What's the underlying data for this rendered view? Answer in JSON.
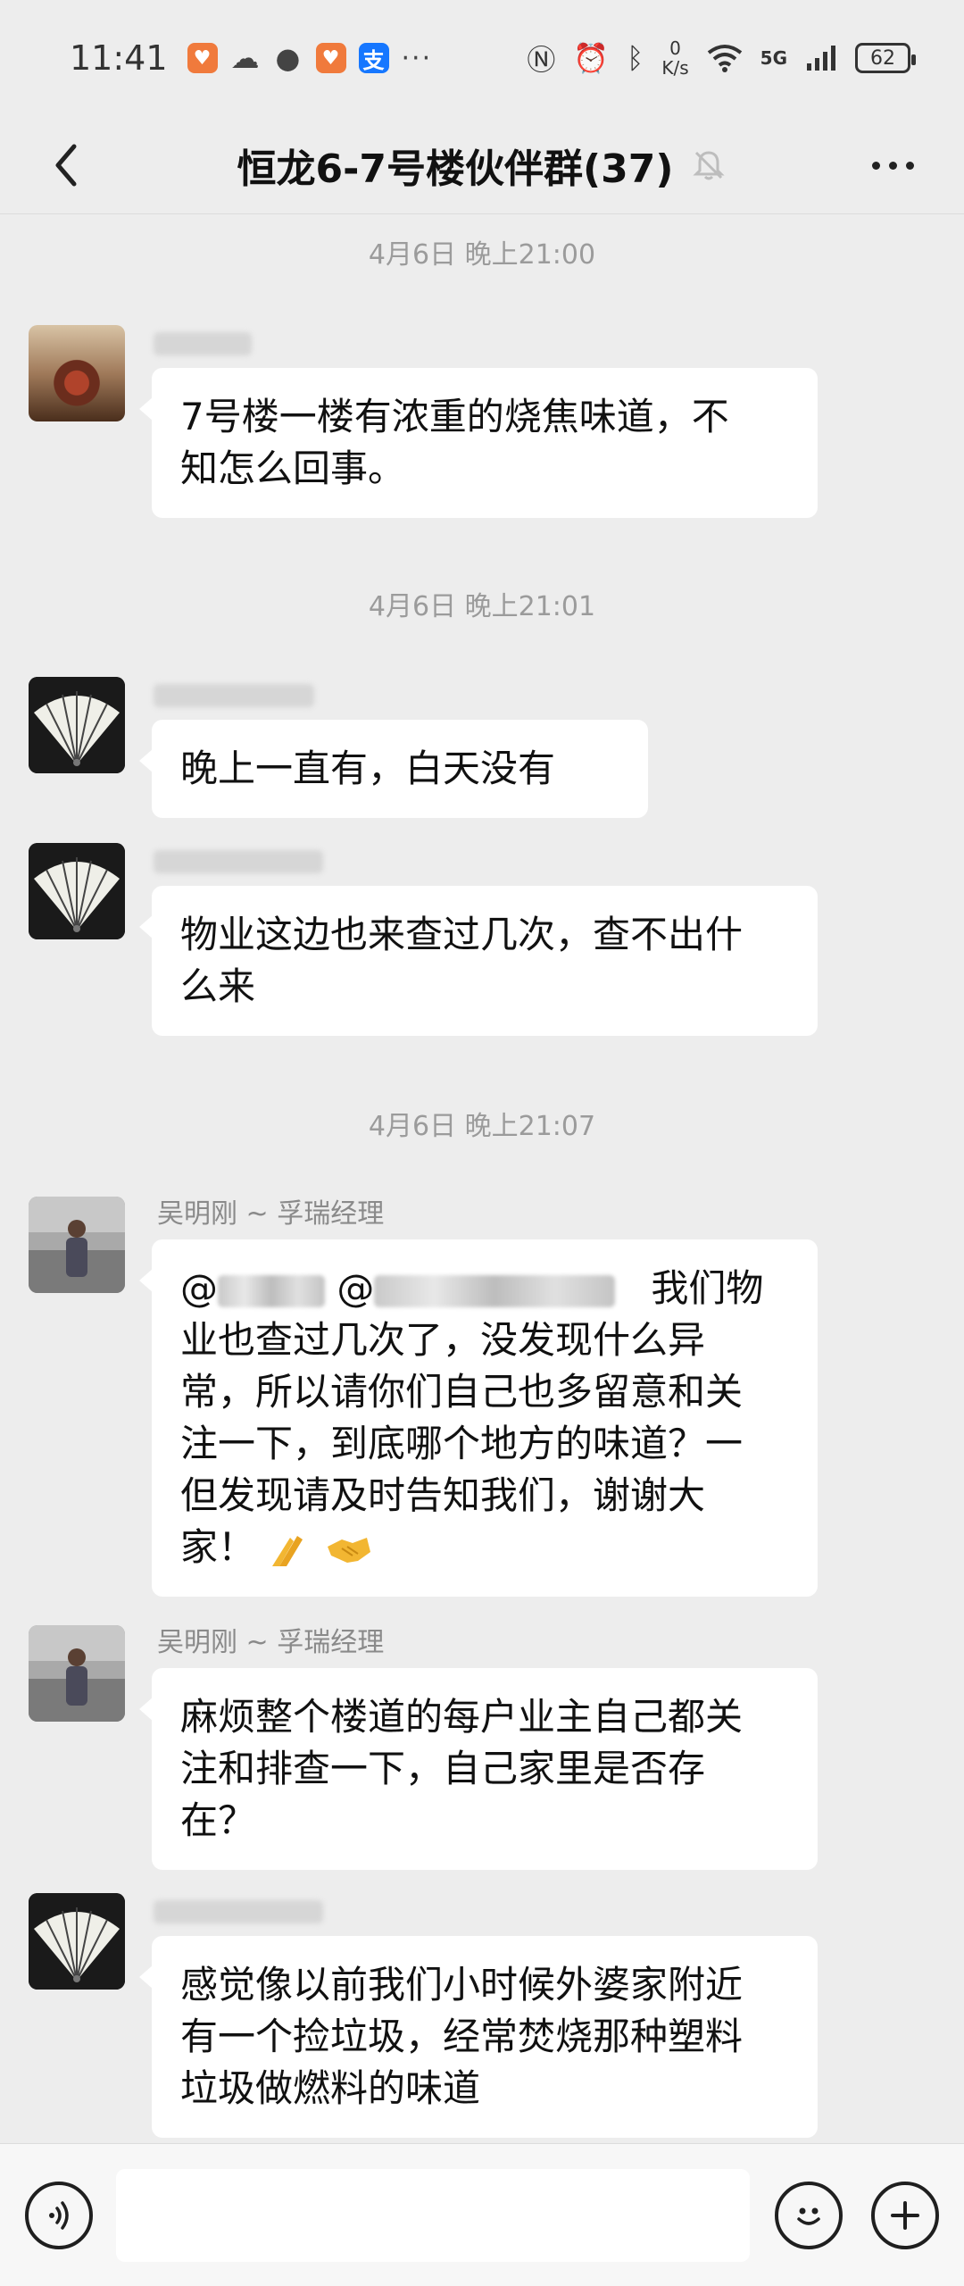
{
  "status_bar": {
    "time": "11:41",
    "more": "···",
    "speed_value": "0",
    "speed_unit": "K/s",
    "network": "5G",
    "battery": "62"
  },
  "header": {
    "title": "恒龙6-7号楼伙伴群(37)"
  },
  "chat": {
    "timestamps": [
      "4月6日 晚上21:00",
      "4月6日 晚上21:01",
      "4月6日 晚上21:07"
    ],
    "messages": [
      {
        "sender": "",
        "lines": [
          "7号楼一楼有浓重的烧焦味道，不",
          "知怎么回事。"
        ]
      },
      {
        "sender": "",
        "lines": [
          "晚上一直有，白天没有"
        ]
      },
      {
        "sender": "",
        "lines": [
          "物业这边也来查过几次，查不出什",
          "么来"
        ]
      },
      {
        "sender": "吴明刚 ~ 孚瑞经理",
        "mention_prefix": "@",
        "mention_prefix2": "@",
        "line1_tail": "我们物",
        "lines": [
          "业也查过几次了，没发现什么异",
          "常，所以请你们自己也多留意和关",
          "注一下，到底哪个地方的味道？一",
          "但发现请及时告知我们，谢谢大",
          "家！"
        ]
      },
      {
        "sender": "吴明刚 ~ 孚瑞经理",
        "lines": [
          "麻烦整个楼道的每户业主自己都关",
          "注和排查一下，自己家里是否存",
          "在？"
        ]
      },
      {
        "sender": "",
        "lines": [
          "感觉像以前我们小时候外婆家附近",
          "有一个捡垃圾，经常焚烧那种塑料",
          "垃圾做燃料的味道"
        ]
      }
    ]
  },
  "icons": {
    "back": "chevron-left-icon",
    "mute": "bell-off-icon",
    "more": "more-dots-icon",
    "voice": "voice-icon",
    "emoji": "emoji-icon",
    "plus": "plus-icon"
  },
  "colors": {
    "background": "#ededed",
    "bubble": "#ffffff",
    "timestamp": "#9b9b9b"
  }
}
